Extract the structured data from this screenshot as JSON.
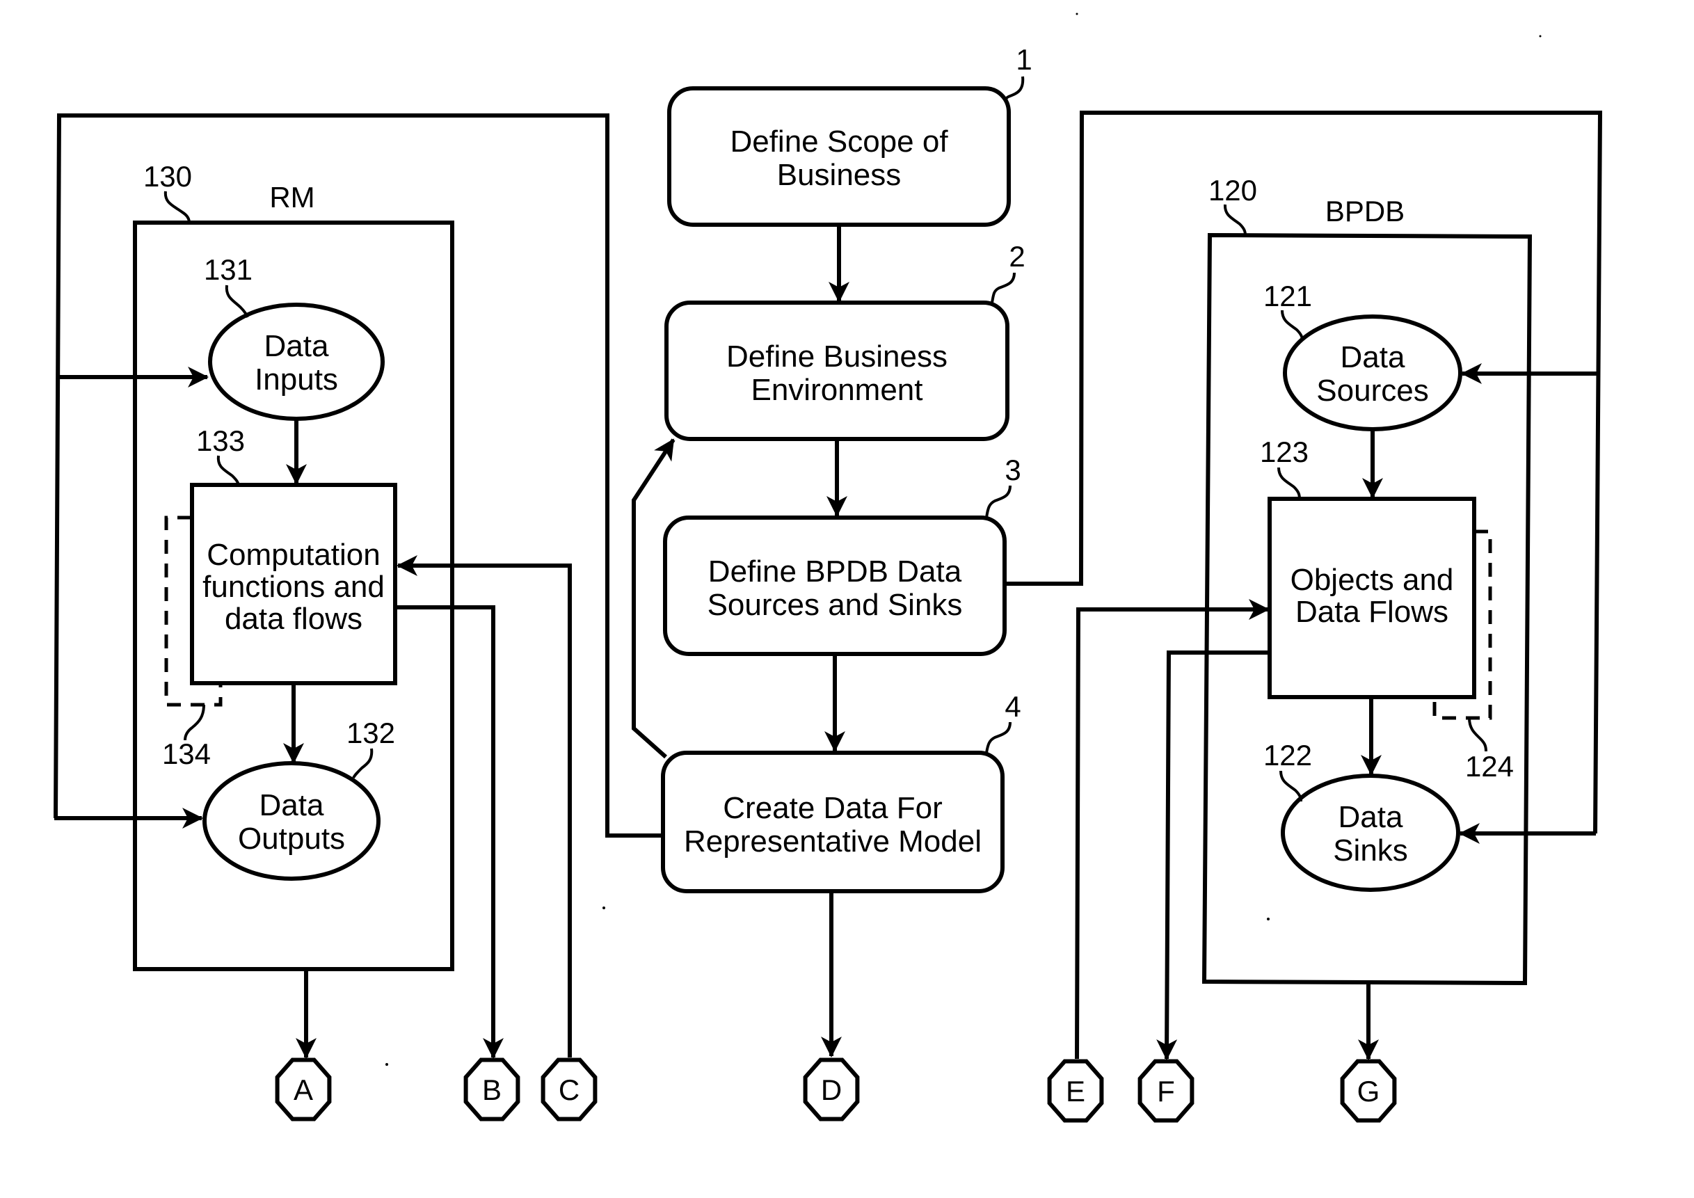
{
  "diagram": {
    "process_steps": [
      {
        "ref": "1",
        "lines": [
          "Define Scope of",
          "Business"
        ]
      },
      {
        "ref": "2",
        "lines": [
          "Define Business",
          "Environment"
        ]
      },
      {
        "ref": "3",
        "lines": [
          "Define BPDB Data",
          "Sources and Sinks"
        ]
      },
      {
        "ref": "4",
        "lines": [
          "Create Data For",
          "Representative Model"
        ]
      }
    ],
    "rm": {
      "title": "RM",
      "ref": "130",
      "data_inputs": {
        "ref": "131",
        "lines": [
          "Data",
          "Inputs"
        ]
      },
      "computation": {
        "ref": "133",
        "lines": [
          "Computation",
          "functions and",
          "data flows"
        ]
      },
      "dashed_ref": "134",
      "data_outputs": {
        "ref": "132",
        "lines": [
          "Data",
          "Outputs"
        ]
      }
    },
    "bpdb": {
      "title": "BPDB",
      "ref": "120",
      "data_sources": {
        "ref": "121",
        "lines": [
          "Data",
          "Sources"
        ]
      },
      "objects": {
        "ref": "123",
        "lines": [
          "Objects and",
          "Data Flows"
        ]
      },
      "dashed_ref": "124",
      "data_sinks": {
        "ref": "122",
        "lines": [
          "Data",
          "Sinks"
        ]
      }
    },
    "connectors": [
      "A",
      "B",
      "C",
      "D",
      "E",
      "F",
      "G"
    ]
  }
}
